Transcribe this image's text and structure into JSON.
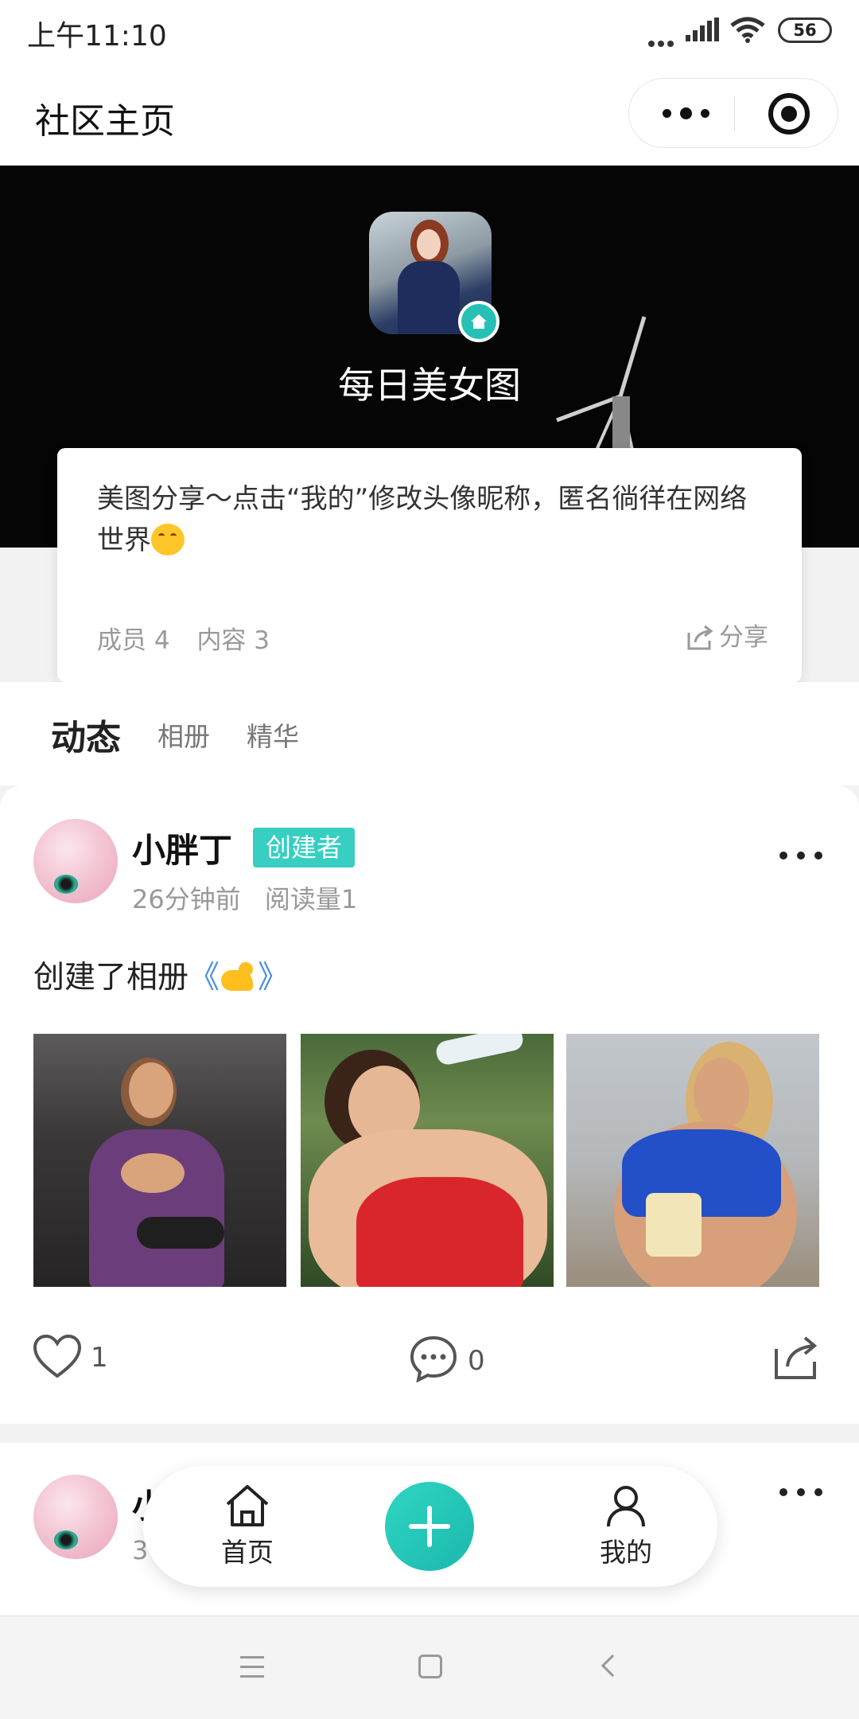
{
  "status": {
    "time": "上午11:10",
    "battery": "56"
  },
  "nav": {
    "title": "社区主页"
  },
  "community": {
    "name": "每日美女图",
    "description": "美图分享～点击“我的”修改头像昵称，匿名徜徉在网络世界",
    "members": "成员 4",
    "contents": "内容 3",
    "share_label": "分享"
  },
  "tabs": [
    {
      "label": "动态",
      "active": true
    },
    {
      "label": "相册",
      "active": false
    },
    {
      "label": "精华",
      "active": false
    }
  ],
  "posts": [
    {
      "author": "小胖丁",
      "badge": "创建者",
      "time": "26分钟前",
      "reads": "阅读量1",
      "text_prefix": "创建了相册",
      "album_open": "《",
      "album_close": "》",
      "likes": "1",
      "comments": "0"
    },
    {
      "author": "小",
      "time": "3"
    }
  ],
  "bottom_nav": {
    "home_label": "首页",
    "mine_label": "我的"
  },
  "colors": {
    "accent": "#26c1b4",
    "link": "#4a8ee0"
  }
}
